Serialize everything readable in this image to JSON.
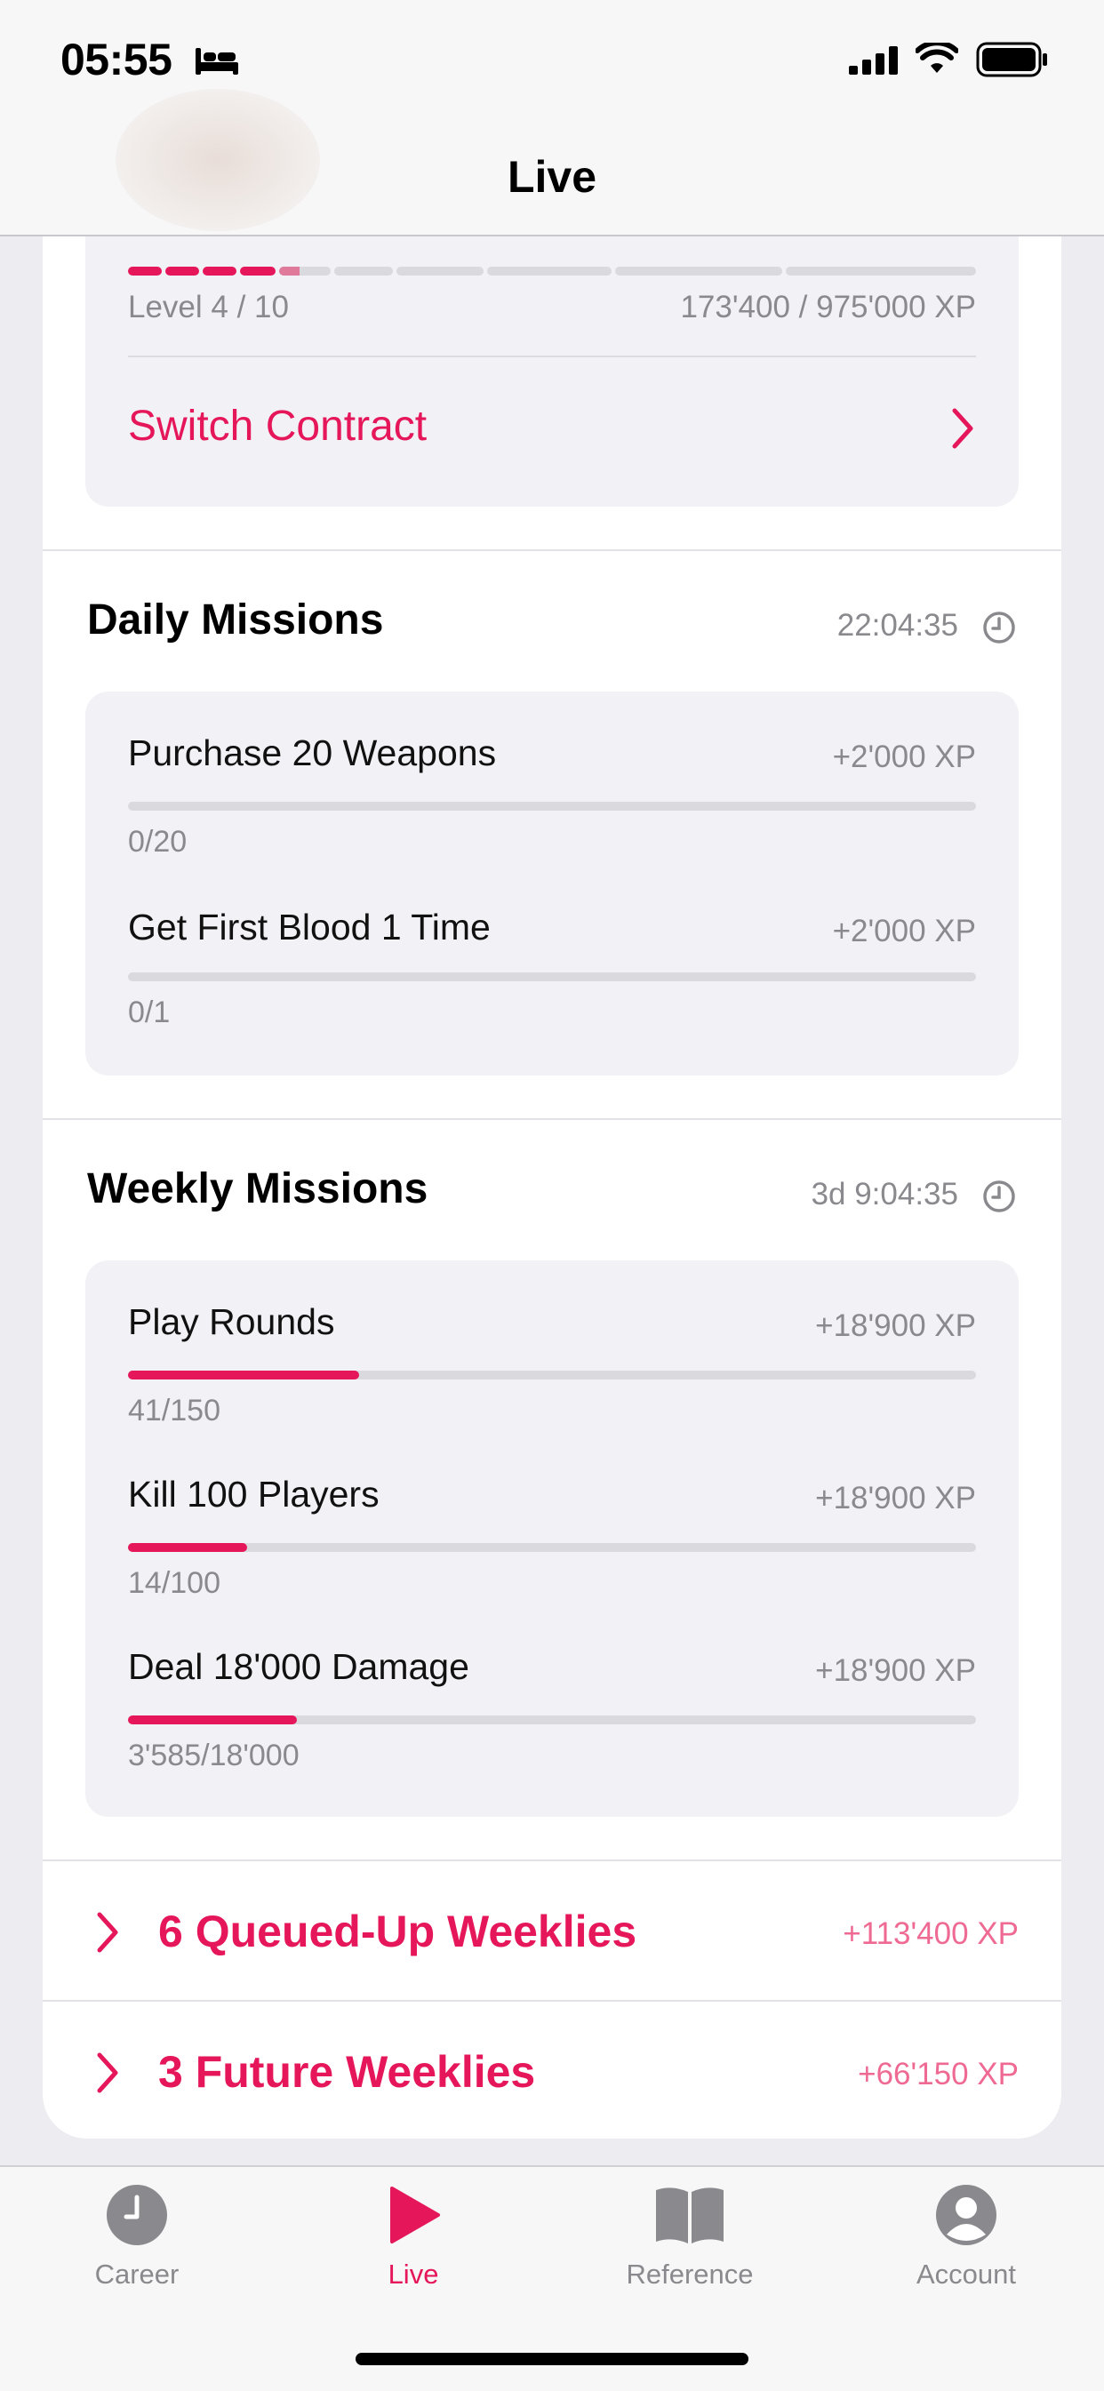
{
  "status_bar": {
    "time": "05:55"
  },
  "nav": {
    "title": "Live"
  },
  "contract": {
    "level": "Level 4 / 10",
    "xp": "173'400 / 975'000 XP",
    "switch_label": "Switch Contract",
    "progress_segments": [
      1,
      1,
      1,
      1,
      0.4,
      0,
      0,
      0,
      0,
      0
    ]
  },
  "daily": {
    "title": "Daily Missions",
    "timer": "22:04:35",
    "missions": [
      {
        "title": "Purchase 20 Weapons",
        "xp": "+2'000 XP",
        "progress": "0/20",
        "fraction": 0
      },
      {
        "title": "Get First Blood 1 Time",
        "xp": "+2'000 XP",
        "progress": "0/1",
        "fraction": 0
      }
    ]
  },
  "weekly": {
    "title": "Weekly Missions",
    "timer": "3d 9:04:35",
    "missions": [
      {
        "title": "Play Rounds",
        "xp": "+18'900 XP",
        "progress": "41/150",
        "fraction": 0.273
      },
      {
        "title": "Kill 100 Players",
        "xp": "+18'900 XP",
        "progress": "14/100",
        "fraction": 0.14
      },
      {
        "title": "Deal 18'000 Damage",
        "xp": "+18'900 XP",
        "progress": "3'585/18'000",
        "fraction": 0.199
      }
    ]
  },
  "queued": {
    "label": "6 Queued-Up Weeklies",
    "xp": "+113'400 XP"
  },
  "future": {
    "label": "3 Future Weeklies",
    "xp": "+66'150 XP"
  },
  "tabs": [
    {
      "label": "Career",
      "icon": "clock-icon",
      "active": false
    },
    {
      "label": "Live",
      "icon": "play-icon",
      "active": true
    },
    {
      "label": "Reference",
      "icon": "book-icon",
      "active": false
    },
    {
      "label": "Account",
      "icon": "person-icon",
      "active": false
    }
  ],
  "colors": {
    "accent": "#e5175a",
    "accent_light": "#ef6a93",
    "card_bg": "#f2f2f6"
  }
}
